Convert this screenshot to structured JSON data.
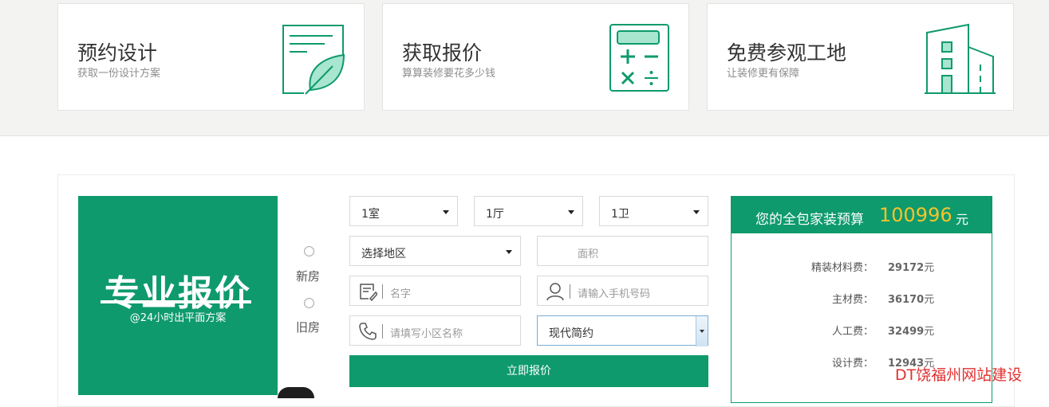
{
  "cards": [
    {
      "title": "预约设计",
      "subtitle": "获取一份设计方案",
      "icon": "leaf-document-icon"
    },
    {
      "title": "获取报价",
      "subtitle": "算算装修要花多少钱",
      "icon": "calculator-icon"
    },
    {
      "title": "免费参观工地",
      "subtitle": "让装修更有保障",
      "icon": "building-icon"
    }
  ],
  "banner": {
    "title": "专业报价",
    "subtitle": "@24小时出平面方案"
  },
  "house_type": {
    "options": [
      "新房",
      "旧房"
    ]
  },
  "form": {
    "room": "1室",
    "hall": "1厅",
    "bath": "1卫",
    "region": "选择地区",
    "area_placeholder": "面积",
    "name_placeholder": "名字",
    "phone_placeholder": "请输入手机号码",
    "community_placeholder": "请填写小区名称",
    "style": "现代简约",
    "submit_label": "立即报价"
  },
  "budget": {
    "label": "您的全包家装预算",
    "total": "100996",
    "unit": "元",
    "rows": [
      {
        "label": "精装材料费：",
        "value": "29172",
        "unit": "元"
      },
      {
        "label": "主材费：",
        "value": "36170",
        "unit": "元"
      },
      {
        "label": "人工费：",
        "value": "32499",
        "unit": "元"
      },
      {
        "label": "设计费：",
        "value": "12943",
        "unit": "元"
      }
    ]
  },
  "watermark": "DT饶福州网站建设",
  "colors": {
    "brand": "#0e9a6d",
    "accent": "#f6c32c",
    "watermark": "#e0312f"
  }
}
